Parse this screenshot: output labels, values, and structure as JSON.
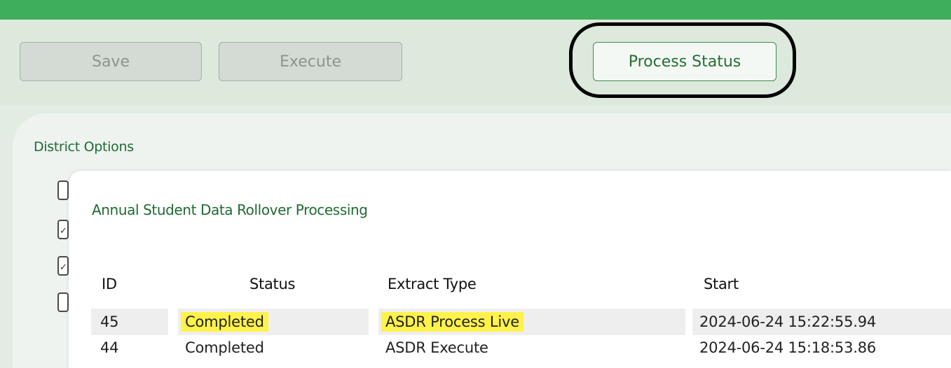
{
  "toolbar": {
    "save_label": "Save",
    "execute_label": "Execute",
    "process_status_label": "Process Status"
  },
  "panel": {
    "title": "District Options",
    "checkboxes": [
      {
        "checked": false
      },
      {
        "checked": true
      },
      {
        "checked": true
      },
      {
        "checked": false
      }
    ]
  },
  "modal": {
    "title": "Annual Student Data Rollover Processing",
    "columns": [
      "ID",
      "Status",
      "Extract Type",
      "Start"
    ],
    "rows": [
      {
        "id": "45",
        "status": "Completed",
        "extract_type": "ASDR Process Live",
        "start": "2024-06-24 15:22:55.94"
      },
      {
        "id": "44",
        "status": "Completed",
        "extract_type": "ASDR Execute",
        "start": "2024-06-24 15:18:53.86"
      }
    ]
  },
  "colors": {
    "accent_green": "#3fae5a",
    "highlight_yellow": "#fff24a"
  }
}
